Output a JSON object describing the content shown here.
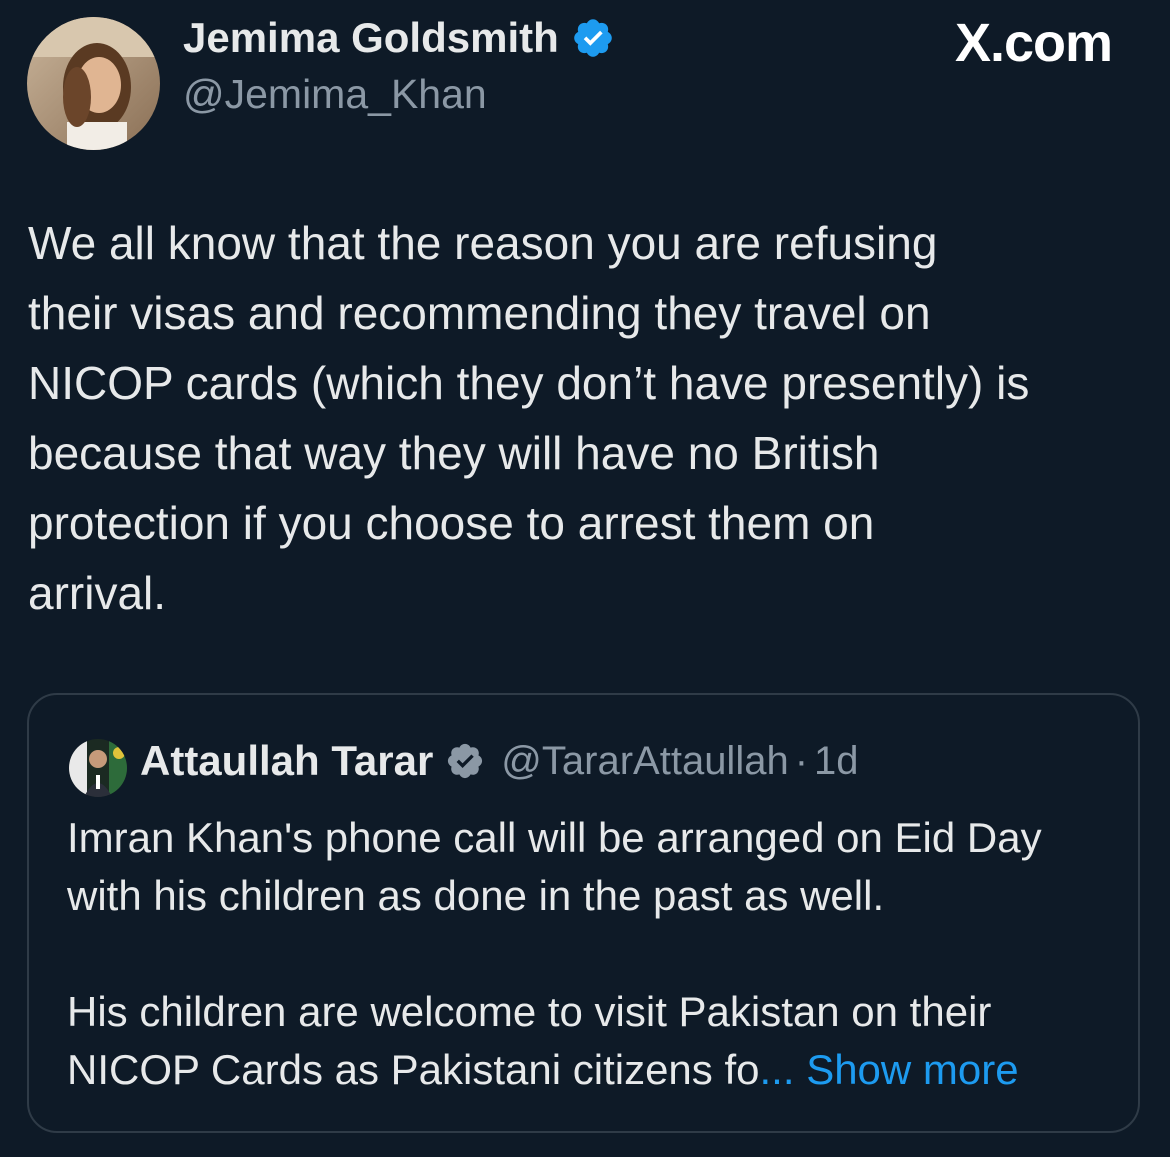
{
  "tweet": {
    "author_name": "Jemima Goldsmith",
    "author_handle": "@Jemima_Khan",
    "site_label": "X.com",
    "avatar_icon": "profile-photo-avatar",
    "verified_icon": "verified-badge-icon",
    "text_lines": [
      "We all know that the reason you are refusing",
      "their visas and recommending they travel on",
      "NICOP cards (which they don’t have presently) is",
      "because that way they will have no British",
      "protection if you choose to arrest them on",
      "arrival."
    ]
  },
  "quoted_tweet": {
    "author_name": "Attaullah Tarar",
    "author_handle": "@TararAttaullah",
    "separator": "·",
    "time": "1d",
    "text_lines": [
      "Imran Khan's phone call will be arranged on Eid Day",
      "with his children as done in the past as well.",
      "",
      "His children are welcome to visit Pakistan on their"
    ],
    "last_line": "NICOP Cards as Pakistani citizens fo",
    "ellipsis": "...",
    "show_more": "Show more"
  },
  "colors": {
    "background": "#0e1a27",
    "text": "#e7e9ea",
    "muted": "#8b98a5",
    "link": "#1d9bf0",
    "verified": "#1d9bf0",
    "border": "#2f3b47"
  }
}
